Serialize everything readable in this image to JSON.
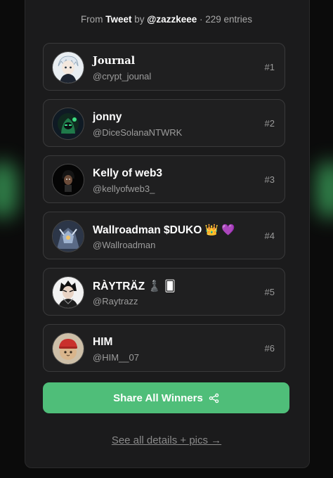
{
  "source": {
    "from_label": "From",
    "platform": "Tweet",
    "by_label": "by",
    "author": "@zazzkeee",
    "separator": "·",
    "entries": "229 entries"
  },
  "winners": [
    {
      "name": "Journal",
      "handle": "@crypt_jounal",
      "rank": "#1",
      "avatar_icon": "anime-boy-avatar-icon"
    },
    {
      "name": "jonny",
      "handle": "@DiceSolanaNTWRK",
      "rank": "#2",
      "avatar_icon": "green-hooded-avatar-icon"
    },
    {
      "name": "Kelly of web3",
      "handle": "@kellyofweb3_",
      "rank": "#3",
      "avatar_icon": "dark-character-avatar-icon"
    },
    {
      "name": "Wallroadman $DUKO 👑 💜",
      "handle": "@Wallroadman",
      "rank": "#4",
      "avatar_icon": "armored-warrior-avatar-icon"
    },
    {
      "name": "RÀYTRÄZ ♟️ 🂠",
      "handle": "@Raytrazz",
      "rank": "#5",
      "avatar_icon": "anime-character-avatar-icon"
    },
    {
      "name": "HIM",
      "handle": "@HIM__07",
      "rank": "#6",
      "avatar_icon": "cat-red-cap-avatar-icon"
    }
  ],
  "share_button": {
    "label": "Share All Winners",
    "icon": "share-icon"
  },
  "details_link": {
    "label": "See all details + pics →"
  },
  "colors": {
    "accent": "#4fbe79",
    "panel": "#1b1b1c",
    "card": "#1f1f20"
  }
}
